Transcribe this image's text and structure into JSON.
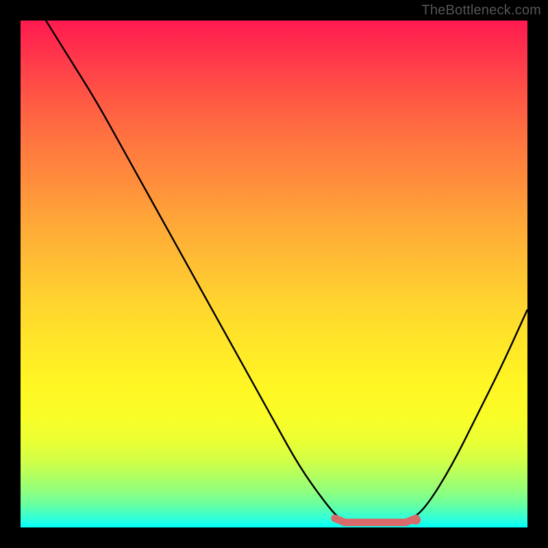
{
  "watermark": "TheBottleneck.com",
  "chart_data": {
    "type": "line",
    "title": "",
    "xlabel": "",
    "ylabel": "",
    "xlim": [
      0,
      100
    ],
    "ylim": [
      0,
      100
    ],
    "curve_points": [
      {
        "x": 5,
        "y": 100
      },
      {
        "x": 10,
        "y": 92
      },
      {
        "x": 15,
        "y": 84
      },
      {
        "x": 20,
        "y": 75
      },
      {
        "x": 25,
        "y": 66
      },
      {
        "x": 30,
        "y": 57
      },
      {
        "x": 35,
        "y": 48
      },
      {
        "x": 40,
        "y": 39
      },
      {
        "x": 45,
        "y": 30
      },
      {
        "x": 50,
        "y": 21
      },
      {
        "x": 55,
        "y": 12
      },
      {
        "x": 60,
        "y": 5
      },
      {
        "x": 63,
        "y": 1.5
      },
      {
        "x": 66,
        "y": 0.6
      },
      {
        "x": 70,
        "y": 0.4
      },
      {
        "x": 74,
        "y": 0.6
      },
      {
        "x": 77,
        "y": 1.5
      },
      {
        "x": 80,
        "y": 4
      },
      {
        "x": 85,
        "y": 12
      },
      {
        "x": 90,
        "y": 22
      },
      {
        "x": 95,
        "y": 32
      },
      {
        "x": 100,
        "y": 43
      }
    ],
    "flat_region": {
      "x_start": 62,
      "x_end": 78,
      "y": 1
    },
    "marker_point": {
      "x": 78,
      "y": 1.5
    },
    "colors": {
      "curve": "#000000",
      "marker_stroke": "#d86a6a",
      "marker_fill": "#d86a6a"
    }
  }
}
